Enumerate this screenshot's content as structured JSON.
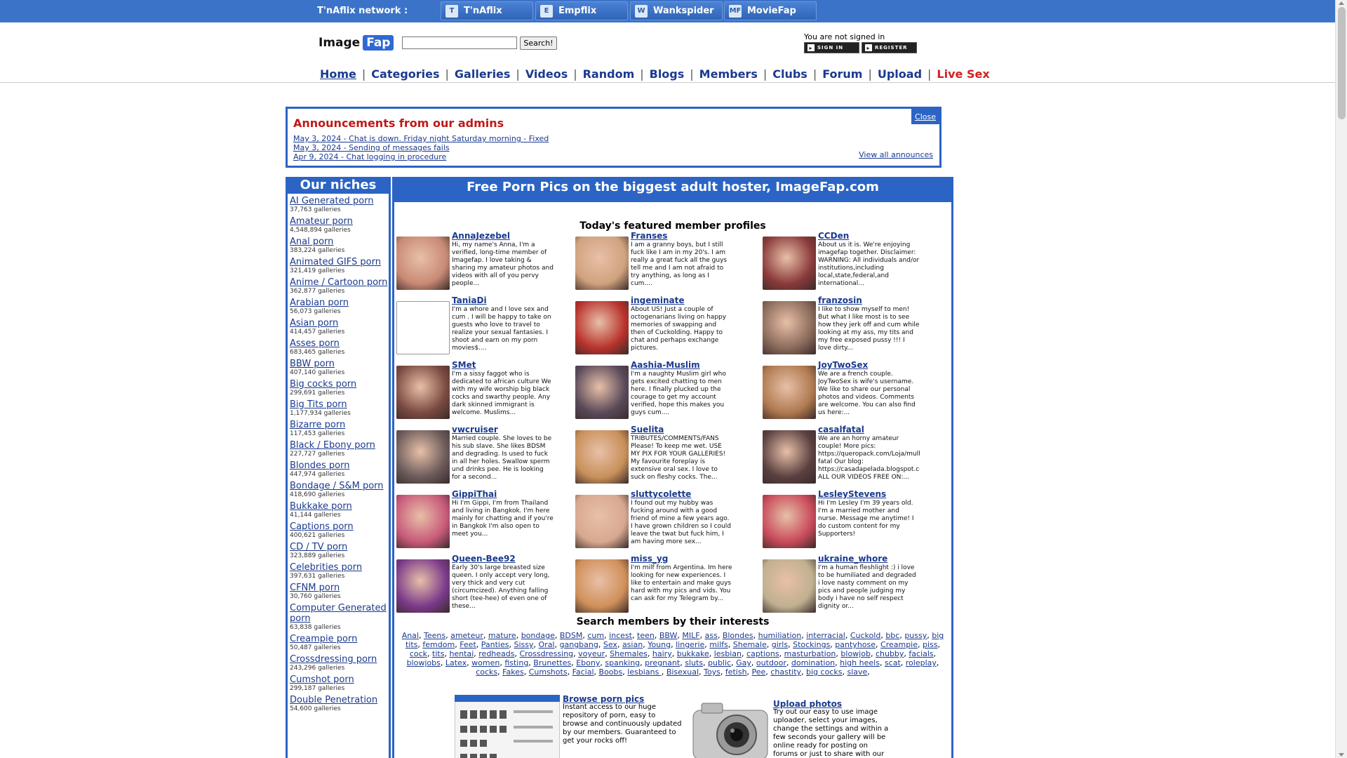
{
  "network": {
    "label": "T'nAflix network :",
    "tabs": [
      {
        "label": "T'nAflix",
        "icon": "tnaflix-icon",
        "glyph": "T"
      },
      {
        "label": "Empflix",
        "icon": "empflix-icon",
        "glyph": "E"
      },
      {
        "label": "Wankspider",
        "icon": "wankspider-icon",
        "glyph": "W"
      },
      {
        "label": "MovieFap",
        "icon": "moviefap-icon",
        "glyph": "MF"
      }
    ]
  },
  "header": {
    "logo_left": "Image",
    "logo_right": "Fap",
    "search_value": "",
    "search_button": "Search!",
    "signin_text": "You are not signed in",
    "signin_label": "SIGN IN",
    "register_label": "REGISTER"
  },
  "nav": [
    {
      "label": "Home"
    },
    {
      "label": "Categories"
    },
    {
      "label": "Galleries"
    },
    {
      "label": "Videos"
    },
    {
      "label": "Random"
    },
    {
      "label": "Blogs"
    },
    {
      "label": "Members"
    },
    {
      "label": "Clubs"
    },
    {
      "label": "Forum"
    },
    {
      "label": "Upload"
    },
    {
      "label": "Live Sex"
    }
  ],
  "announcements": {
    "title": "Announcements from our admins",
    "close": "Close",
    "items": [
      "May 3, 2024 - Chat is down. Friday night Saturday morning - Fixed",
      "May 3, 2024 - Sending of messages fails",
      "Apr 9, 2024 - Chat logging in procedure"
    ],
    "view_all": "View all announces"
  },
  "niches": {
    "title": "Our niches",
    "items": [
      {
        "name": "AI Generated porn",
        "count": "37,763 galleries"
      },
      {
        "name": "Amateur porn",
        "count": "4,548,894 galleries"
      },
      {
        "name": "Anal porn",
        "count": "383,224 galleries"
      },
      {
        "name": "Animated GIFS porn",
        "count": "321,419 galleries"
      },
      {
        "name": "Anime / Cartoon porn",
        "count": "362,877 galleries"
      },
      {
        "name": "Arabian porn",
        "count": "56,073 galleries"
      },
      {
        "name": "Asian porn",
        "count": "414,457 galleries"
      },
      {
        "name": "Asses porn",
        "count": "683,465 galleries"
      },
      {
        "name": "BBW porn",
        "count": "407,140 galleries"
      },
      {
        "name": "Big cocks porn",
        "count": "299,691 galleries"
      },
      {
        "name": "Big Tits porn",
        "count": "1,177,934 galleries"
      },
      {
        "name": "Bizarre porn",
        "count": "117,453 galleries"
      },
      {
        "name": "Black / Ebony porn",
        "count": "227,727 galleries"
      },
      {
        "name": "Blondes porn",
        "count": "447,974 galleries"
      },
      {
        "name": "Bondage / S&M porn",
        "count": "418,690 galleries"
      },
      {
        "name": "Bukkake porn",
        "count": "41,144 galleries"
      },
      {
        "name": "Captions porn",
        "count": "400,621 galleries"
      },
      {
        "name": "CD / TV porn",
        "count": "323,889 galleries"
      },
      {
        "name": "Celebrities porn",
        "count": "397,631 galleries"
      },
      {
        "name": "CFNM porn",
        "count": "30,760 galleries"
      },
      {
        "name": "Computer Generated porn",
        "count": "63,838 galleries"
      },
      {
        "name": "Creampie porn",
        "count": "50,487 galleries"
      },
      {
        "name": "Crossdressing porn",
        "count": "243,296 galleries"
      },
      {
        "name": "Cumshot porn",
        "count": "299,187 galleries"
      },
      {
        "name": "Double Penetration",
        "count": "54,600 galleries"
      }
    ]
  },
  "content": {
    "title": "Free Porn Pics on the biggest adult hoster, ImageFap.com",
    "featured_title": "Today's featured member profiles",
    "profiles": [
      {
        "name": "AnnaJezebel",
        "desc": "Hi, my name's Anna, I'm a verified, long-time member of Imagefap. I love taking & sharing my amateur photos and videos with all of you pervy people...",
        "color": "#c98a74"
      },
      {
        "name": "Franses",
        "desc": "I am a granny boys, but I still fuck like I am in my 20's. I am really a great fuck all the guys tell me and I am not afraid to try anything, as long as I cum....",
        "color": "#d0a27e"
      },
      {
        "name": "CCDen",
        "desc": "About us it is. We're enjoying imagefap together. Disclaimer: WARNING: All individuals and/or institutions,including local,state,federal,and international...",
        "color": "#8a3a3a"
      },
      {
        "name": "TaniaDi",
        "desc": "I'm a whore and I love sex and cum . I will be happy to take on guests who love to travel to realize your sexual fantasies. I shoot and earn on my porn movies$....",
        "color": ""
      },
      {
        "name": "ingeminate",
        "desc": "About US! Just a couple of octogenarians living on happy memories of swapping and then of Cuckolding. Happy to chat and perhaps exchange pictures.",
        "color": "#b8322c"
      },
      {
        "name": "franzosin",
        "desc": "I like to show myself to men! But what I like most is to see how they jerk off and cum while looking at my ass, my tits and my free exposed pussy !!! I love dirty...",
        "color": "#8a6a5a"
      },
      {
        "name": "SMet",
        "desc": "I'm a sissy faggot who is dedicated to african culture We with my wife worship big black cocks and swarthy people. Any dark skinned immigrant is welcome. Muslims...",
        "color": "#7a4a40"
      },
      {
        "name": "Aashia-Muslim",
        "desc": "I'm a naughty Muslim girl who gets excited chatting to men here. I finally plucked up the courage to get my account verified, hope this makes you guys cum....",
        "color": "#5a4a5a"
      },
      {
        "name": "JoyTwoSex",
        "desc": "We are a french couple. JoyTwoSex is wife's username. We like to share our personal photos and videos. Comments are welcome. You can also find us here:...",
        "color": "#b07a50"
      },
      {
        "name": "vwcruiser",
        "desc": "Married couple. She loves to be his sub slave. She likes BDSM and degrading. Is used to fuck in all her holes. Swallow sperm und drinks pee. He is looking for a second...",
        "color": "#6a5a5a"
      },
      {
        "name": "Suelita",
        "desc": "TRIBUTES/COMMENTS/FANS Please! To keep me wet. USE MY PIX FOR YOUR GALLERIES! My favourite foreplay is extensive oral sex. I love to suck on fleshy cocks. The...",
        "color": "#c8905a"
      },
      {
        "name": "casalfatal",
        "desc": "We are an horny amateur couple! More pics: https://queropack.com/Loja/mulher-fatal Our blog: https://casadapelada.blogspot.com/ ALL OUR VIDEOS FREE ON:...",
        "color": "#5a4040"
      },
      {
        "name": "GippiThai",
        "desc": "Hi I'm Gippi, I'm from Thailand and living in Bangkok. I'm here mainly for chatting and if you're in Bangkok I'm also open to meet you...",
        "color": "#c85a7a"
      },
      {
        "name": "sluttycolette",
        "desc": "I found out my hubby was fucking around with a good friend of mine a few years ago. I have grown children so I could leave the twat but fuck him, I am having more sex...",
        "color": "#d8a890"
      },
      {
        "name": "LesleyStevens",
        "desc": "Hi I'm Lesley I'm 39 years old. I'm a married mother and nurse. Message me anytime! I do custom content for my Supporters!",
        "color": "#c84a5a"
      },
      {
        "name": "Queen-Bee92",
        "desc": "Early 30's large breasted size queen. I only accept very long, very thick and very cut (circumcized). Anything falling short (tee-hee) of even one of these...",
        "color": "#7a3a8a"
      },
      {
        "name": "miss_yg",
        "desc": "I'm milf from Argentina. Im here looking for new experiences. I like to entertain and make guys hard with my pics and vids. You can ask for my Telegram by...",
        "color": "#d0905a"
      },
      {
        "name": "ukraine_whore",
        "desc": "I'm a human fleshlight :) i love to be humiliated and degraded i love nasty comment on my pics and people judging my body i have no self respect dignity or...",
        "color": "#c0b090"
      }
    ],
    "interests_title": "Search members by their interests",
    "interests": [
      "Anal",
      "Teens",
      "ameteur",
      "mature",
      "bondage",
      "BDSM",
      "cum",
      "incest",
      "teen",
      "BBW",
      "MILF",
      "ass",
      "Blondes",
      "humiliation",
      "interracial",
      "Cuckold",
      "bbc",
      "pussy",
      "big tits",
      "femdom",
      "Feet",
      "Panties",
      "Sissy",
      "Oral",
      "gangbang",
      "Sex",
      "asian",
      "Young",
      "lingerie",
      "milfs",
      "Shemale",
      "girls",
      "Stockings",
      "pantyhose",
      "Creampie",
      "piss",
      "cock",
      "tits",
      "hentai",
      "redheads",
      "Crossdressing",
      "voyeur",
      "Shemales",
      "hairy",
      "bukkake",
      "lesbian",
      "captions",
      "masturbation",
      "blowjob",
      "chubby",
      "facials",
      "blowjobs",
      "Latex",
      "women",
      "fisting",
      "Brunettes",
      "Ebony",
      "spanking",
      "pregnant",
      "sluts",
      "public",
      "Gay",
      "outdoor",
      "domination",
      "high heels",
      "scat",
      "roleplay",
      "cocks",
      "Fakes",
      "Cumshots",
      "Facial",
      "Boobs",
      "lesbians ",
      "Bisexual",
      "Toys",
      "fetish",
      "Pee",
      "chastity",
      "big cocks",
      "slave"
    ],
    "browse": {
      "title": "Browse porn pics",
      "text": "Instant access to our huge repository of porn, easy to browse and continuously updated by our members. Guaranteed to get your rocks off!"
    },
    "upload": {
      "title": "Upload photos",
      "text": "Try out our easy to use image uploader, select your images, change the settings and within a few seconds your gallery will be online ready for posting on forums or just to share with our"
    }
  }
}
